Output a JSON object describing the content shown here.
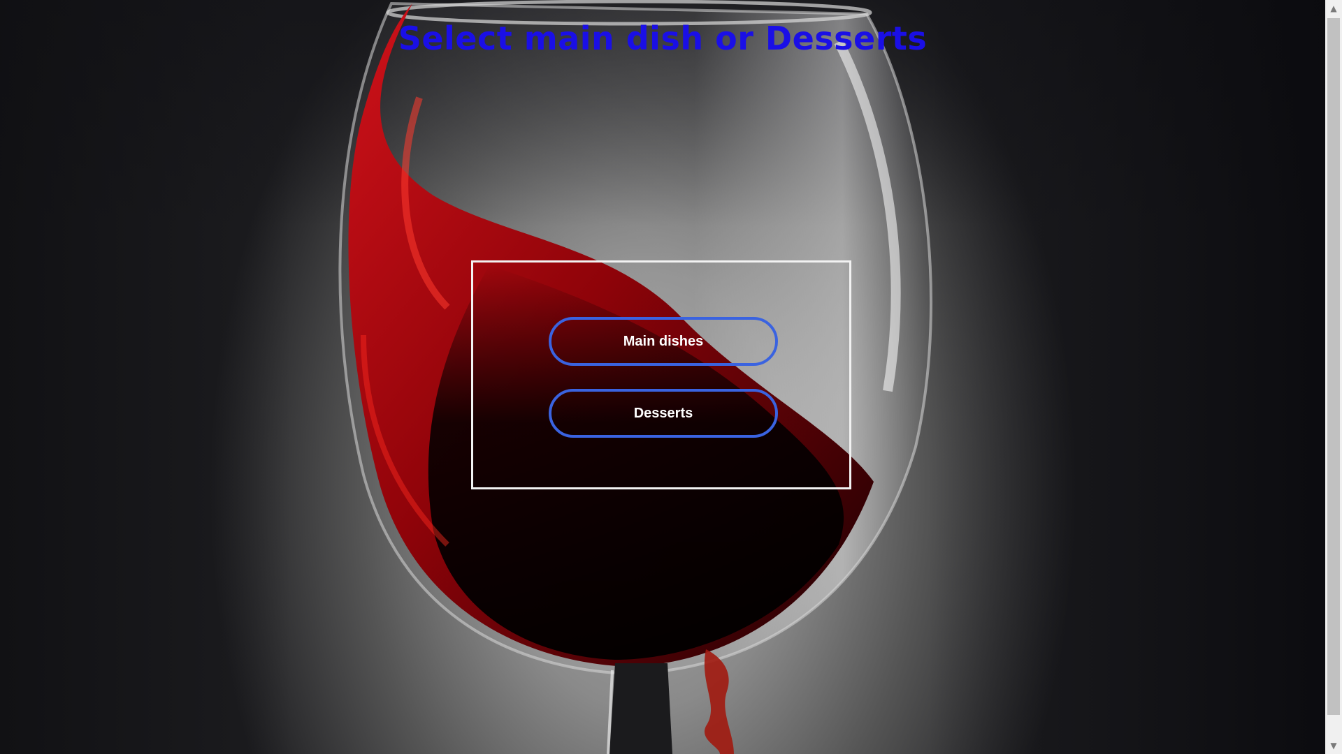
{
  "page": {
    "title": "Select main dish or Desserts"
  },
  "menu": {
    "main_dishes_label": "Main dishes",
    "desserts_label": "Desserts"
  },
  "scrollbar": {
    "up_arrow": "▲",
    "down_arrow": "▼"
  },
  "background": {
    "image": "red-wine-glass"
  },
  "colors": {
    "title": "#1a0fe6",
    "button_border": "#3a63e0",
    "box_border": "#f2f2f2",
    "wine": "#b0070e"
  }
}
